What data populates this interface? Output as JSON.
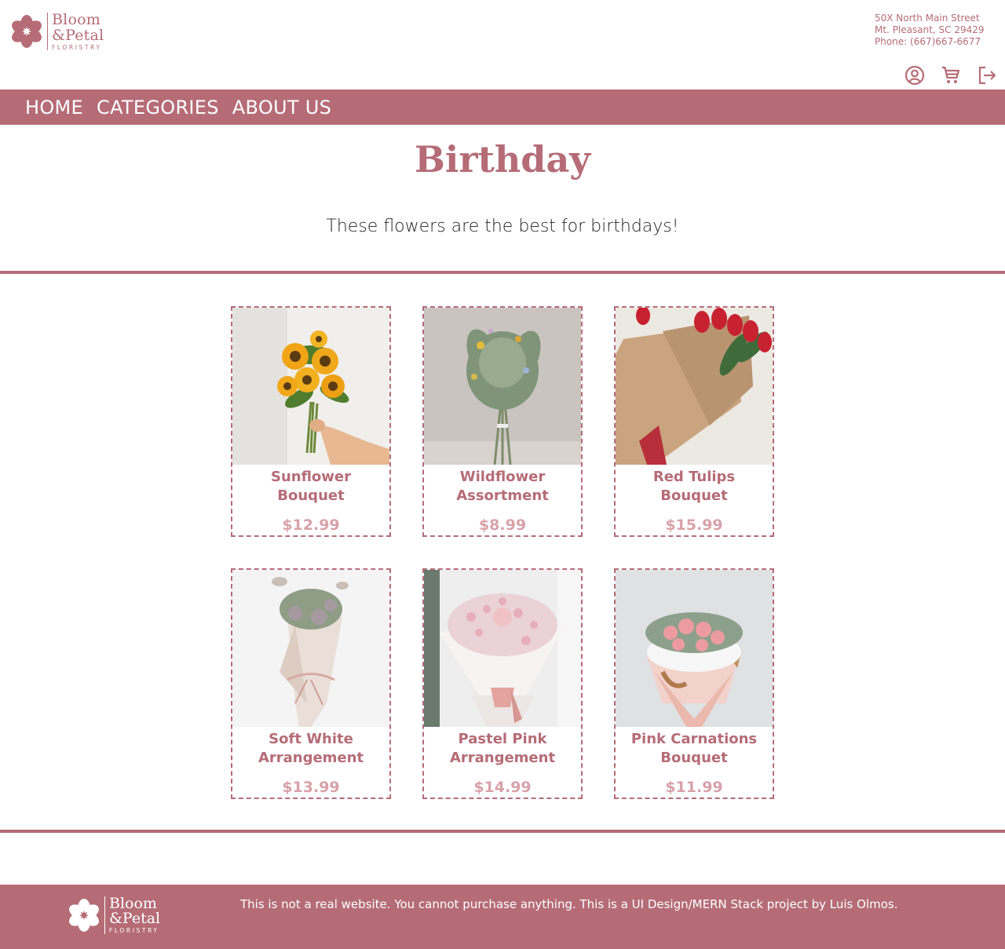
{
  "brand": {
    "line1": "Bloom",
    "line2": "&Petal",
    "line3": "FLORISTRY",
    "color": "#b56c77"
  },
  "contact": {
    "street": "50X North Main Street",
    "city": "Mt. Pleasant, SC 29429",
    "phone": "Phone: (667)667-6677"
  },
  "header_icons": [
    "account-icon",
    "cart-icon",
    "logout-icon"
  ],
  "nav": {
    "home": "HOME",
    "categories": "CATEGORIES",
    "about": "ABOUT US"
  },
  "page": {
    "title": "Birthday",
    "description": "These flowers are the best for birthdays!"
  },
  "products": [
    {
      "name": "Sunflower Bouquet",
      "price": "$12.99",
      "image": "sunflower-bouquet-photo"
    },
    {
      "name": "Wildflower Assortment",
      "price": "$8.99",
      "image": "wildflower-assortment-photo"
    },
    {
      "name": "Red Tulips Bouquet",
      "price": "$15.99",
      "image": "red-tulips-photo"
    },
    {
      "name": "Soft White Arrangement",
      "price": "$13.99",
      "image": "soft-white-arrangement-photo"
    },
    {
      "name": "Pastel Pink Arrangement",
      "price": "$14.99",
      "image": "pastel-pink-arrangement-photo"
    },
    {
      "name": "Pink Carnations Bouquet",
      "price": "$11.99",
      "image": "pink-carnations-photo"
    }
  ],
  "footer": {
    "disclaimer": "This is not a real website. You cannot purchase anything. This is a UI Design/MERN Stack project by Luis Olmos."
  },
  "colors": {
    "accent": "#b56c77",
    "price": "#d7a2aa",
    "text": "#222222"
  }
}
